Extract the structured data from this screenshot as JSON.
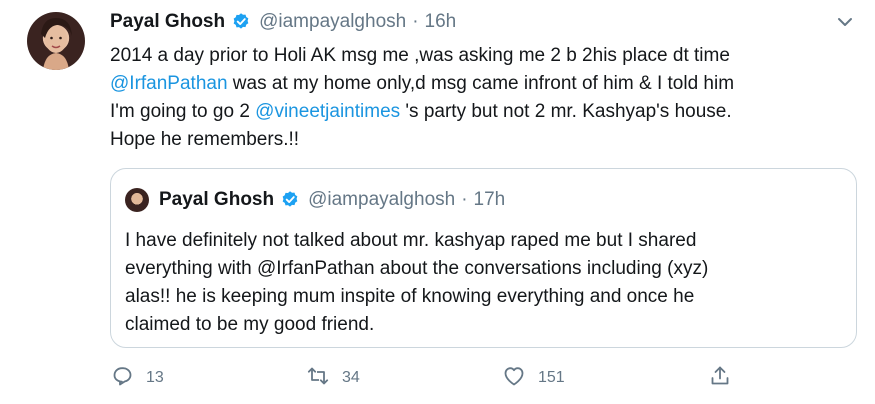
{
  "tweet": {
    "author_name": "Payal Ghosh",
    "handle": "@iampayalghosh",
    "separator": "·",
    "time": "16h",
    "text_lines": [
      {
        "parts": [
          {
            "text": "2014 a day prior to Holi AK msg me ,was asking me 2 b 2his place dt time"
          }
        ]
      },
      {
        "parts": [
          {
            "text": "@IrfanPathan",
            "mention": true
          },
          {
            "text": " was at my home only,d msg came infront of him & I told him"
          }
        ]
      },
      {
        "parts": [
          {
            "text": "I'm going to go 2 "
          },
          {
            "text": "@vineetjaintimes",
            "mention": true
          },
          {
            "text": " 's party but not 2 mr. Kashyap's house."
          }
        ]
      },
      {
        "parts": [
          {
            "text": "Hope he remembers.!!"
          }
        ]
      }
    ]
  },
  "quoted": {
    "author_name": "Payal Ghosh",
    "handle": "@iampayalghosh",
    "separator": "·",
    "time": "17h",
    "text_lines": [
      "I have definitely not talked about mr. kashyap raped me but I shared",
      "everything with @IrfanPathan about the conversations including (xyz)",
      "alas!! he is keeping mum inspite of knowing everything and once he",
      "claimed to be my good friend."
    ]
  },
  "actions": {
    "reply_count": "13",
    "retweet_count": "34",
    "like_count": "151"
  },
  "icons": {
    "verified": "verified-badge-icon",
    "more": "chevron-down-icon",
    "reply": "reply-icon",
    "retweet": "retweet-icon",
    "like": "heart-icon",
    "share": "share-icon"
  },
  "colors": {
    "text": "#14171a",
    "secondary": "#657786",
    "link": "#1b95e0",
    "border": "#ccd6dd"
  }
}
